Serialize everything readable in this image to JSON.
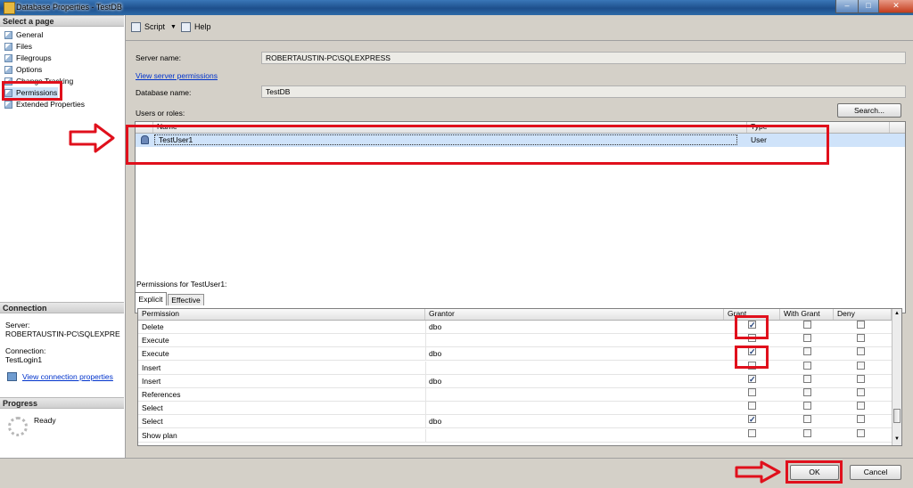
{
  "window": {
    "title": "Database Properties - TestDB"
  },
  "left": {
    "select_page_header": "Select a page",
    "pages": [
      {
        "label": "General"
      },
      {
        "label": "Files"
      },
      {
        "label": "Filegroups"
      },
      {
        "label": "Options"
      },
      {
        "label": "Change Tracking"
      },
      {
        "label": "Permissions"
      },
      {
        "label": "Extended Properties"
      }
    ],
    "connection_header": "Connection",
    "server_label": "Server:",
    "server_value": "ROBERTAUSTIN-PC\\SQLEXPRE",
    "connection_label": "Connection:",
    "connection_value": "TestLogin1",
    "view_connection_properties": "View connection properties",
    "progress_header": "Progress",
    "progress_status": "Ready"
  },
  "toolbar": {
    "script_label": "Script",
    "help_label": "Help"
  },
  "main": {
    "server_name_label": "Server name:",
    "server_name_value": "ROBERTAUSTIN-PC\\SQLEXPRESS",
    "view_server_permissions": "View server permissions",
    "database_name_label": "Database name:",
    "database_name_value": "TestDB",
    "users_roles_label": "Users or roles:",
    "search_button": "Search...",
    "users_grid": {
      "col_name": "Name",
      "col_type": "Type",
      "rows": [
        {
          "name": "TestUser1",
          "type": "User"
        }
      ]
    },
    "permissions_for_label": "Permissions for TestUser1:",
    "tabs": [
      {
        "label": "Explicit"
      },
      {
        "label": "Effective"
      }
    ],
    "perm_grid": {
      "col_permission": "Permission",
      "col_grantor": "Grantor",
      "col_grant": "Grant",
      "col_with_grant": "With Grant",
      "col_deny": "Deny",
      "rows": [
        {
          "permission": "Delete",
          "grantor": "dbo",
          "grant": true,
          "with_grant": false,
          "deny": false
        },
        {
          "permission": "Execute",
          "grantor": "",
          "grant": false,
          "with_grant": false,
          "deny": false
        },
        {
          "permission": "Execute",
          "grantor": "dbo",
          "grant": true,
          "with_grant": false,
          "deny": false
        },
        {
          "permission": "Insert",
          "grantor": "",
          "grant": false,
          "with_grant": false,
          "deny": false
        },
        {
          "permission": "Insert",
          "grantor": "dbo",
          "grant": true,
          "with_grant": false,
          "deny": false
        },
        {
          "permission": "References",
          "grantor": "",
          "grant": false,
          "with_grant": false,
          "deny": false
        },
        {
          "permission": "Select",
          "grantor": "",
          "grant": false,
          "with_grant": false,
          "deny": false
        },
        {
          "permission": "Select",
          "grantor": "dbo",
          "grant": true,
          "with_grant": false,
          "deny": false
        },
        {
          "permission": "Show plan",
          "grantor": "",
          "grant": false,
          "with_grant": false,
          "deny": false
        }
      ]
    }
  },
  "footer": {
    "ok_button": "OK",
    "cancel_button": "Cancel"
  },
  "icons": {
    "app": "database-icon",
    "page": "page-icon",
    "script": "script-icon",
    "help": "help-icon",
    "user": "user-icon",
    "connection": "connection-icon",
    "progress": "progress-spinner-icon",
    "annotation_arrow": "red-arrow-icon"
  },
  "colors": {
    "annotation": "#e0101c",
    "selection": "#cde3f8",
    "link": "#0033cc"
  }
}
